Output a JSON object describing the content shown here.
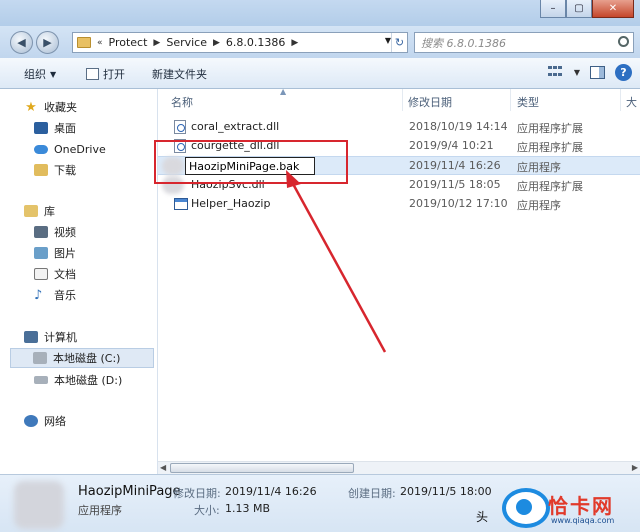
{
  "address": {
    "prefix": "«",
    "crumbs": [
      "Protect",
      "Service",
      "6.8.0.1386"
    ],
    "search_placeholder": "搜索 6.8.0.1386"
  },
  "toolbar": {
    "organize": "组织",
    "open": "打开",
    "new_folder": "新建文件夹"
  },
  "window": {
    "minimize": "–",
    "maximize": "▢",
    "close": "✕"
  },
  "nav": {
    "favorites": "收藏夹",
    "desktop": "桌面",
    "onedrive": "OneDrive",
    "downloads": "下载",
    "library": "库",
    "videos": "视频",
    "pictures": "图片",
    "documents": "文档",
    "music": "音乐",
    "computer": "计算机",
    "local_c": "本地磁盘 (C:)",
    "local_d": "本地磁盘 (D:)",
    "network": "网络"
  },
  "columns": {
    "name": "名称",
    "date": "修改日期",
    "type": "类型",
    "size": "大"
  },
  "files": [
    {
      "name": "coral_extract.dll",
      "date": "2018/10/19 14:14",
      "type": "应用程序扩展",
      "icon": "dll-icon"
    },
    {
      "name": "courgette_dll.dll",
      "date": "2019/9/4 10:21",
      "type": "应用程序扩展",
      "icon": "dll-icon"
    },
    {
      "name": "HaozipMiniPage.bak",
      "date": "2019/11/4 16:26",
      "type": "应用程序",
      "icon": "blurred-icon"
    },
    {
      "name": "HaozipSvc.dll",
      "date": "2019/11/5 18:05",
      "type": "应用程序扩展",
      "icon": "blurred-icon"
    },
    {
      "name": "Helper_Haozip",
      "date": "2019/10/12 17:10",
      "type": "应用程序",
      "icon": "exe-icon"
    }
  ],
  "details": {
    "name": "HaozipMiniPage",
    "type": "应用程序",
    "modified_label": "修改日期:",
    "modified_value": "2019/11/4 16:26",
    "created_label": "创建日期:",
    "created_value": "2019/11/5 18:00",
    "size_label": "大小:",
    "size_value": "1.13 MB"
  },
  "watermark": {
    "brand": "恰卡网",
    "url": "www.qiaqa.com",
    "tou": "头"
  },
  "colors": {
    "highlight_box": "#d7262e",
    "arrow": "#d7262e",
    "selection": "#dceaf9"
  }
}
